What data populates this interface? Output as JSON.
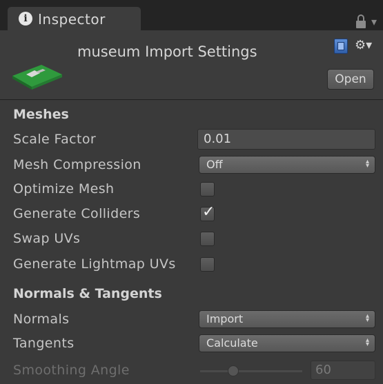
{
  "tab": {
    "title": "Inspector",
    "info_icon": "i"
  },
  "header": {
    "title": "museum Import Settings",
    "open_label": "Open"
  },
  "meshes": {
    "section_title": "Meshes",
    "scale_factor": {
      "label": "Scale Factor",
      "value": "0.01"
    },
    "mesh_compression": {
      "label": "Mesh Compression",
      "value": "Off"
    },
    "optimize_mesh": {
      "label": "Optimize Mesh",
      "checked": false
    },
    "generate_colliders": {
      "label": "Generate Colliders",
      "checked": true
    },
    "swap_uvs": {
      "label": "Swap UVs",
      "checked": false
    },
    "generate_lightmap_uvs": {
      "label": "Generate Lightmap UVs",
      "checked": false
    }
  },
  "normals_tangents": {
    "section_title": "Normals & Tangents",
    "normals": {
      "label": "Normals",
      "value": "Import"
    },
    "tangents": {
      "label": "Tangents",
      "value": "Calculate"
    },
    "smoothing_angle": {
      "label": "Smoothing Angle",
      "value": "60"
    }
  },
  "colors": {
    "background": "#3a3a3a",
    "tab_bar": "#242424",
    "model_green": "#3bb54a"
  },
  "icons": [
    "info-icon",
    "lock-icon",
    "menu-dots-icon",
    "help-icon",
    "gear-icon",
    "checkmark-icon",
    "dropdown-arrows-icon"
  ]
}
